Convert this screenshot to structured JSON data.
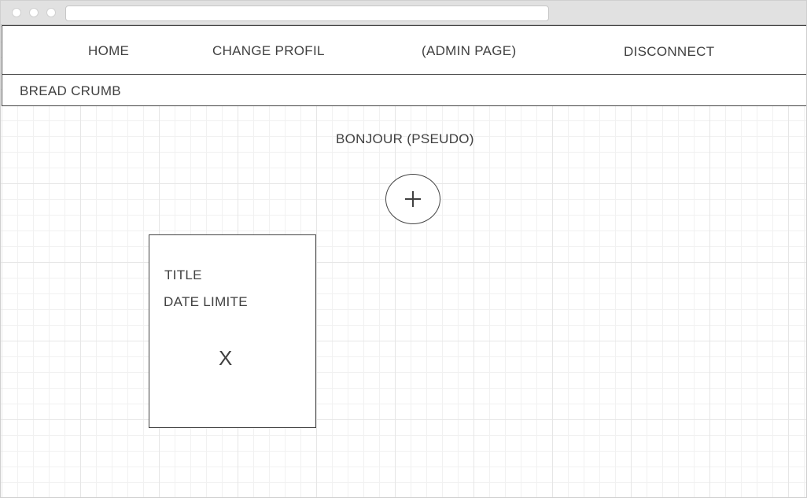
{
  "nav": {
    "home": "HOME",
    "change_profil": "CHANGE PROFIL",
    "admin_page": "(ADMIN PAGE)",
    "disconnect": "DISCONNECT"
  },
  "breadcrumb": {
    "label": "BREAD CRUMB"
  },
  "main": {
    "greeting": "BONJOUR (PSEUDO)",
    "add_button": {
      "icon": "plus-icon"
    }
  },
  "card": {
    "title": "TITLE",
    "date_label": "DATE LIMITE",
    "close_label": "X"
  },
  "colors": {
    "text": "#404040",
    "border": "#444444",
    "grid_major": "#e6e6e6",
    "grid_minor": "#f1f1f1",
    "browser_chrome": "#e1e1e1"
  }
}
